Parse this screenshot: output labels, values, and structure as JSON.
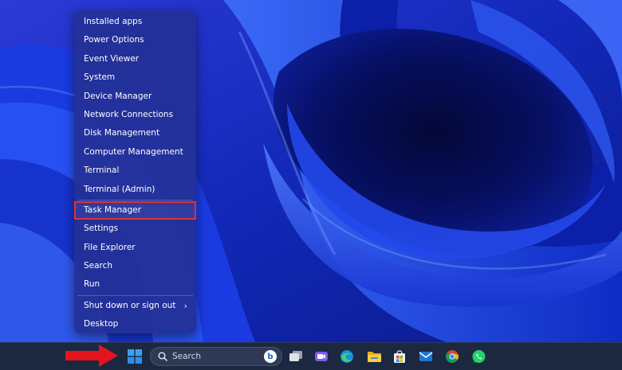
{
  "menu": {
    "items": [
      {
        "label": "Installed apps"
      },
      {
        "label": "Power Options"
      },
      {
        "label": "Event Viewer"
      },
      {
        "label": "System"
      },
      {
        "label": "Device Manager"
      },
      {
        "label": "Network Connections"
      },
      {
        "label": "Disk Management"
      },
      {
        "label": "Computer Management"
      },
      {
        "label": "Terminal"
      },
      {
        "label": "Terminal (Admin)"
      },
      {
        "label": "Task Manager",
        "highlighted": true
      },
      {
        "label": "Settings"
      },
      {
        "label": "File Explorer"
      },
      {
        "label": "Search"
      },
      {
        "label": "Run"
      },
      {
        "label": "Shut down or sign out",
        "has_submenu": true
      },
      {
        "label": "Desktop"
      }
    ],
    "highlight_color": "#e0303a"
  },
  "taskbar": {
    "search": {
      "placeholder": "Search",
      "badge": "b"
    },
    "icons": [
      "windows-start-icon",
      "task-view-icon",
      "meet-video-icon",
      "edge-browser-icon",
      "file-explorer-icon",
      "microsoft-store-icon",
      "mail-icon",
      "chrome-icon",
      "whatsapp-icon"
    ],
    "arrow_color": "#e4141c"
  },
  "colors": {
    "wallpaper_deep": "#050c4a",
    "wallpaper_bright": "#2a50f0",
    "menu_bg": "#243096",
    "taskbar_bg": "#1c2740"
  }
}
